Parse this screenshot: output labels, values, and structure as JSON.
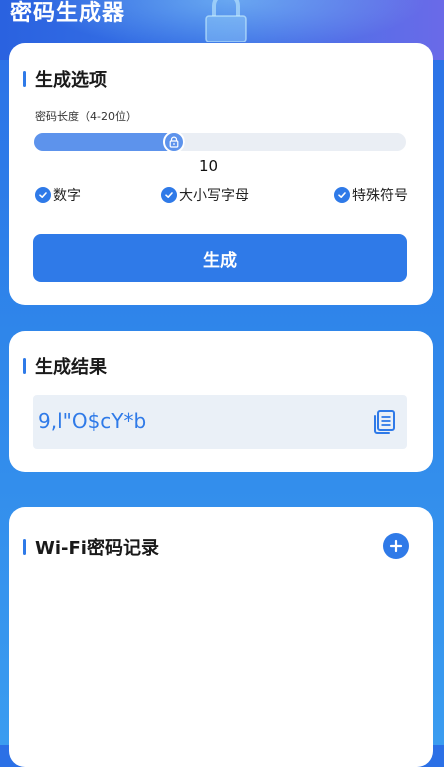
{
  "header": {
    "title": "密码生成器",
    "lock_icon": "lock-icon"
  },
  "options": {
    "title": "生成选项",
    "length_label": "密码长度（4-20位）",
    "slider": {
      "min": 4,
      "max": 20,
      "value": 10,
      "value_text": "10"
    },
    "checkboxes": [
      {
        "label": "数字",
        "checked": true
      },
      {
        "label": "大小写字母",
        "checked": true
      },
      {
        "label": "特殊符号",
        "checked": true
      }
    ],
    "generate_label": "生成"
  },
  "result": {
    "title": "生成结果",
    "password": "9,l\"O$cY*b",
    "copy_icon": "copy-icon"
  },
  "records": {
    "title": "Wi-Fi密码记录",
    "add_icon": "plus-circle-icon"
  },
  "colors": {
    "accent": "#2f7ae8",
    "slider_fill": "#5d93ec",
    "result_bg": "#eaf0f7"
  }
}
